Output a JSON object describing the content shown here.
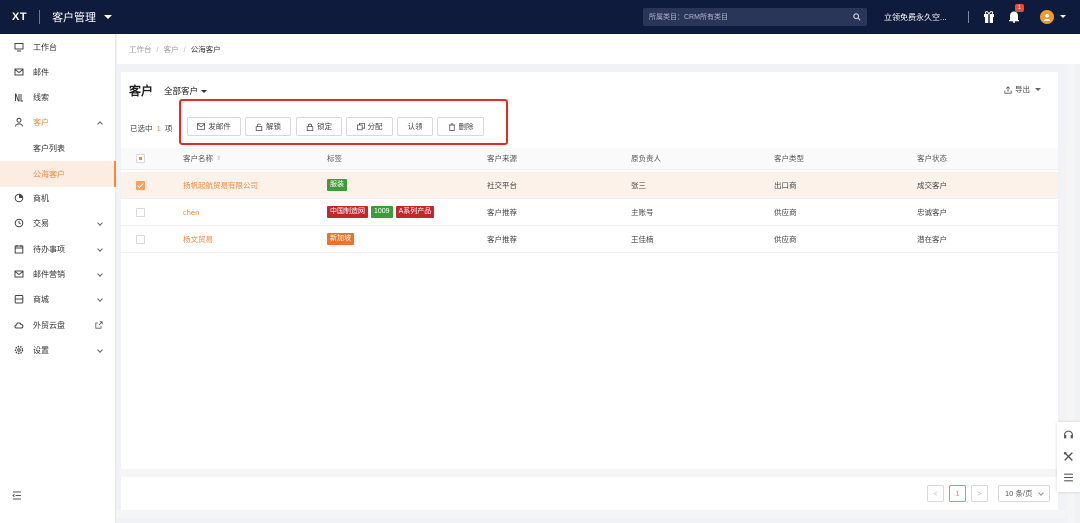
{
  "topbar": {
    "logo": "XT",
    "app_title": "客户管理",
    "search_placeholder": "所属类目：CRM所有类目",
    "free_link": "立领免费永久空...",
    "notification_count": "1"
  },
  "sidebar": {
    "items": [
      {
        "label": "工作台",
        "icon": "monitor-icon"
      },
      {
        "label": "邮件",
        "icon": "mail-icon"
      },
      {
        "label": "线索",
        "icon": "clue-icon"
      },
      {
        "label": "客户",
        "icon": "user-icon"
      },
      {
        "label": "商机",
        "icon": "opportunity-icon"
      },
      {
        "label": "交易",
        "icon": "clock-icon"
      },
      {
        "label": "待办事项",
        "icon": "calendar-icon"
      },
      {
        "label": "邮件营销",
        "icon": "mail-marketing-icon"
      },
      {
        "label": "商城",
        "icon": "store-icon"
      },
      {
        "label": "外贸云盘",
        "icon": "cloud-icon"
      },
      {
        "label": "设置",
        "icon": "gear-icon"
      }
    ],
    "sub_items": [
      {
        "label": "客户列表"
      },
      {
        "label": "公海客户"
      }
    ]
  },
  "breadcrumb": [
    "工作台",
    "客户",
    "公海客户"
  ],
  "main": {
    "title": "客户",
    "view_select": "全部客户",
    "export": "导出",
    "selection_prefix": "已选中",
    "selection_count": "1",
    "selection_suffix": "项",
    "actions": [
      {
        "label": "发邮件",
        "icon": "mail-icon"
      },
      {
        "label": "解锁",
        "icon": "unlock-icon"
      },
      {
        "label": "锁定",
        "icon": "lock-icon"
      },
      {
        "label": "分配",
        "icon": "assign-icon"
      },
      {
        "label": "认领",
        "icon": ""
      },
      {
        "label": "删除",
        "icon": "trash-icon"
      }
    ]
  },
  "table": {
    "columns": [
      "客户名称",
      "标签",
      "客户来源",
      "原负责人",
      "客户类型",
      "客户状态"
    ],
    "rows": [
      {
        "name": "扬帆起航贸易有限公司",
        "tags": [
          {
            "text": "服装",
            "color": "#3d9c38"
          }
        ],
        "source": "社交平台",
        "owner": "张三",
        "type": "出口商",
        "status": "成交客户",
        "checked": true
      },
      {
        "name": "chen",
        "tags": [
          {
            "text": "中国制造网",
            "color": "#c0282d"
          },
          {
            "text": "1009",
            "color": "#3d9c38"
          },
          {
            "text": "A系列产品",
            "color": "#c0282d"
          }
        ],
        "source": "客户推荐",
        "owner": "主账号",
        "type": "供应商",
        "status": "忠诚客户",
        "checked": false
      },
      {
        "name": "杨文贸易",
        "tags": [
          {
            "text": "新加坡",
            "color": "#f0702c"
          }
        ],
        "source": "客户推荐",
        "owner": "王佳楠",
        "type": "供应商",
        "status": "潜在客户",
        "checked": false
      }
    ]
  },
  "pagination": {
    "prev": "<",
    "current": "1",
    "next": ">",
    "page_size": "10 条/页"
  },
  "colors": {
    "topbar": "#0f1b3d",
    "accent": "#f08a3e",
    "highlight": "#e52a2a"
  }
}
